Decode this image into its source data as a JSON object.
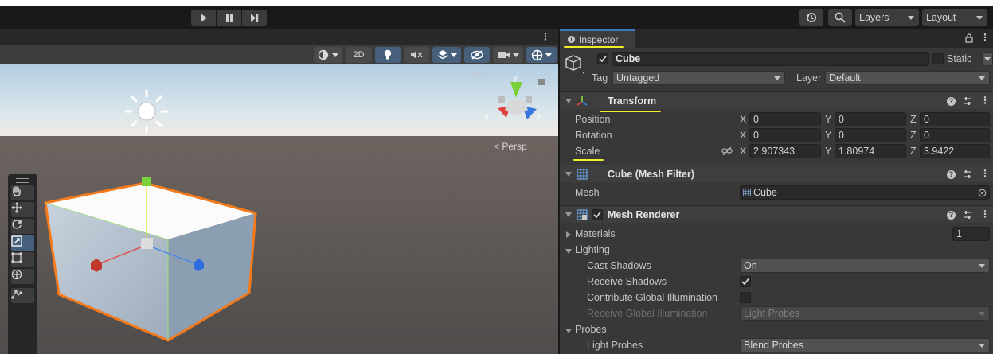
{
  "toolbar": {
    "play_icon": "play-icon",
    "pause_icon": "pause-icon",
    "step_icon": "step-icon",
    "history_icon": "history-icon",
    "search_icon": "search-icon",
    "layers_label": "Layers",
    "layout_label": "Layout"
  },
  "scene": {
    "mode_2d": "2D",
    "persp_label": "Persp",
    "tools": [
      "hand-tool",
      "move-tool",
      "rotate-tool",
      "scale-tool",
      "rect-tool",
      "transform-tool",
      "custom-tool"
    ],
    "selected_tool": "scale-tool",
    "colors": {
      "sky": "#a9c3d9",
      "ground": "#5b5654",
      "selection_outline": "#f47a1c",
      "x_axis": "#e03a3a",
      "y_axis": "#8cd13b",
      "z_axis": "#3a77e0"
    }
  },
  "inspector": {
    "tab_label": "Inspector",
    "object": {
      "name": "Cube",
      "active": true,
      "static_label": "Static",
      "tag_label": "Tag",
      "tag_value": "Untagged",
      "layer_label": "Layer",
      "layer_value": "Default"
    },
    "transform": {
      "title": "Transform",
      "position": {
        "label": "Position",
        "x": "0",
        "y": "0",
        "z": "0"
      },
      "rotation": {
        "label": "Rotation",
        "x": "0",
        "y": "0",
        "z": "0"
      },
      "scale": {
        "label": "Scale",
        "x": "2.907343",
        "y": "1.80974",
        "z": "3.9422"
      },
      "axis_x": "X",
      "axis_y": "Y",
      "axis_z": "Z"
    },
    "mesh_filter": {
      "title": "Cube (Mesh Filter)",
      "mesh_label": "Mesh",
      "mesh_value": "Cube"
    },
    "mesh_renderer": {
      "title": "Mesh Renderer",
      "enabled": true,
      "materials_label": "Materials",
      "materials_count": "1",
      "lighting_label": "Lighting",
      "cast_shadows_label": "Cast Shadows",
      "cast_shadows_value": "On",
      "receive_shadows_label": "Receive Shadows",
      "receive_shadows_checked": true,
      "contribute_gi_label": "Contribute Global Illumination",
      "contribute_gi_checked": false,
      "receive_gi_label": "Receive Global Illumination",
      "receive_gi_value": "Light Probes",
      "probes_label": "Probes",
      "light_probes_label": "Light Probes",
      "light_probes_value": "Blend Probes"
    }
  }
}
